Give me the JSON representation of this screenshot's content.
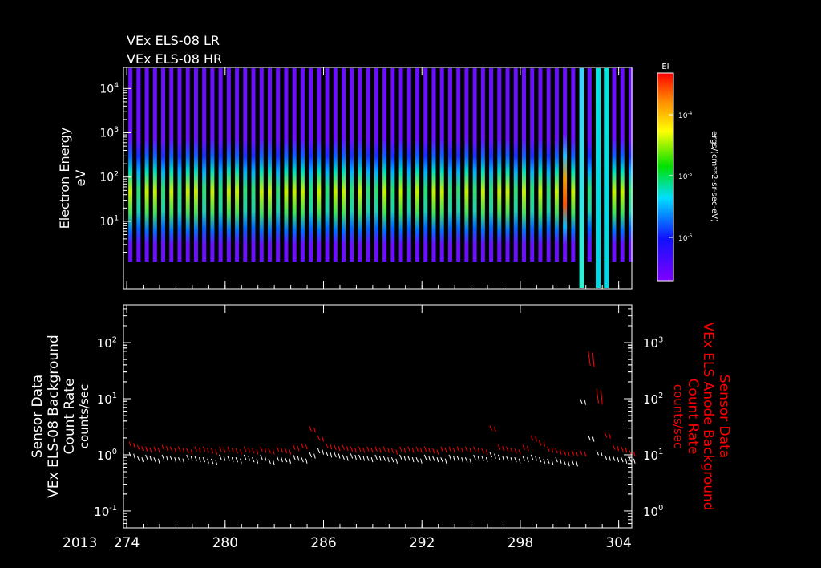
{
  "chart_data": [
    {
      "type": "heatmap",
      "titles": [
        "VEx ELS-08 LR",
        "VEx ELS-08 HR"
      ],
      "ylabel": [
        "Electron Energy",
        "eV"
      ],
      "yscale": "log",
      "ylim": [
        0.3,
        30000
      ],
      "ytick_exponents": [
        4,
        3,
        2,
        1
      ],
      "xlim": [
        273.8,
        304.8
      ],
      "colorbar": {
        "title": "EI",
        "label": "ergs/(cm**2-sr-sec-eV)",
        "tick_exponents": [
          -4,
          -5,
          -6
        ],
        "colormap": "rainbow (purple→red)"
      },
      "orbit_start_day": 274.1,
      "orbit_spacing_days": 0.5,
      "orbit_peak_level": [
        1,
        0,
        1,
        1,
        0,
        1,
        0,
        1,
        1,
        0,
        1,
        0,
        1,
        1,
        0,
        0,
        1,
        1,
        0,
        1,
        1,
        1,
        0,
        1,
        0,
        1,
        1,
        0,
        1,
        0,
        0,
        1,
        0,
        1,
        0,
        1,
        0,
        1,
        1,
        0,
        0,
        1,
        0,
        1,
        0,
        1,
        1,
        0,
        1,
        0,
        1,
        0,
        1,
        2,
        1,
        3,
        0,
        4,
        4,
        1,
        1,
        0
      ]
    },
    {
      "type": "line",
      "xlabel": "",
      "year_label": "2013",
      "x_ticks": [
        274,
        280,
        286,
        292,
        298,
        304
      ],
      "xlim": [
        273.8,
        304.8
      ],
      "left_axis": {
        "label": [
          "Sensor Data",
          "VEx ELS-08 Background",
          "Count Rate",
          "counts/sec"
        ],
        "scale": "log",
        "ylim": [
          0.05,
          470
        ],
        "tick_exponents": [
          2,
          1,
          0,
          -1
        ]
      },
      "right_axis": {
        "label": [
          "Sensor Data",
          "VEx ELS Anode Background",
          "Count Rate",
          "counts/sec"
        ],
        "scale": "log",
        "ylim": [
          0.5,
          4700
        ],
        "tick_exponents": [
          3,
          2,
          1,
          0
        ]
      },
      "series": [
        {
          "name": "VEx ELS-08 Background Count Rate",
          "axis": "left",
          "color": "#ffffff",
          "x_start": 274,
          "x_step": 0.5,
          "values": [
            1.1,
            0.95,
            1.0,
            0.9,
            1.0,
            0.95,
            0.9,
            1.0,
            0.95,
            0.9,
            0.85,
            1.0,
            0.95,
            0.9,
            1.0,
            0.9,
            1.0,
            0.85,
            0.95,
            0.9,
            1.0,
            0.9,
            1.1,
            1.3,
            1.15,
            1.1,
            1.0,
            1.05,
            1.0,
            0.95,
            1.0,
            0.95,
            0.9,
            1.0,
            0.95,
            0.9,
            1.0,
            0.95,
            0.9,
            1.0,
            0.95,
            0.9,
            1.0,
            0.95,
            1.1,
            1.0,
            0.95,
            0.9,
            0.95,
            1.0,
            0.9,
            0.85,
            0.9,
            0.8,
            0.8,
            10,
            2.2,
            1.2,
            1.0,
            0.95,
            0.9,
            0.9
          ]
        },
        {
          "name": "VEx ELS Anode Background Count Rate",
          "axis": "right",
          "color": "#ff0000",
          "x_start": 274,
          "x_step": 0.5,
          "values": [
            17,
            15,
            14,
            14,
            15,
            14,
            14,
            13,
            14,
            14,
            13,
            14,
            14,
            13,
            14,
            13,
            14,
            13,
            14,
            13,
            15,
            16,
            32,
            22,
            16,
            15,
            15,
            14,
            14,
            14,
            14,
            14,
            13,
            14,
            14,
            14,
            14,
            13,
            14,
            14,
            14,
            14,
            14,
            13,
            33,
            15,
            14,
            13,
            15,
            22,
            18,
            14,
            13,
            12,
            12,
            12,
            700,
            150,
            25,
            15,
            14,
            12
          ]
        }
      ]
    }
  ]
}
